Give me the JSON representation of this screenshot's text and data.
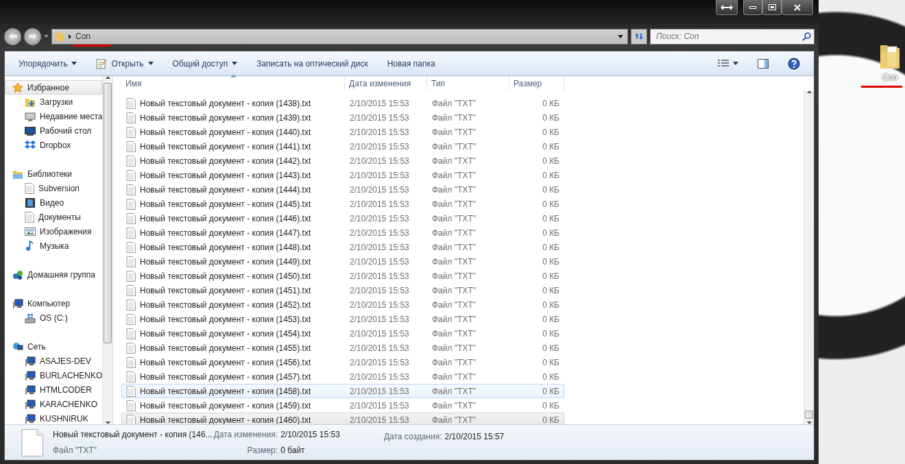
{
  "address_bar": {
    "path": "Con"
  },
  "search": {
    "placeholder": "Поиск: Con"
  },
  "toolbar": [
    {
      "label": "Упорядочить",
      "dropdown": true
    },
    {
      "label": "Открыть",
      "dropdown": true
    },
    {
      "label": "Общий доступ",
      "dropdown": true
    },
    {
      "label": "Записать на оптический диск",
      "dropdown": false
    },
    {
      "label": "Новая папка",
      "dropdown": false
    }
  ],
  "sidebar": {
    "groups": [
      {
        "label": "Избранное",
        "kind": "star",
        "selected": true,
        "children": [
          {
            "label": "Загрузки",
            "kind": "download",
            "selected": false
          },
          {
            "label": "Недавние места",
            "kind": "recent",
            "selected": false
          },
          {
            "label": "Рабочий стол",
            "kind": "desktop",
            "selected": false
          },
          {
            "label": "Dropbox",
            "kind": "dropbox",
            "selected": false
          }
        ]
      },
      {
        "label": "Библиотеки",
        "kind": "library",
        "selected": false,
        "children": [
          {
            "label": "Subversion",
            "kind": "doc",
            "selected": false
          },
          {
            "label": "Видео",
            "kind": "video",
            "selected": false
          },
          {
            "label": "Документы",
            "kind": "doc",
            "selected": false
          },
          {
            "label": "Изображения",
            "kind": "picture",
            "selected": false
          },
          {
            "label": "Музыка",
            "kind": "music",
            "selected": false
          }
        ]
      },
      {
        "label": "Домашняя группа",
        "kind": "homegroup",
        "selected": false
      },
      {
        "label": "Компьютер",
        "kind": "computer",
        "selected": false,
        "children": [
          {
            "label": "OS (C:)",
            "kind": "drive",
            "selected": false
          }
        ]
      },
      {
        "label": "Сеть",
        "kind": "network",
        "selected": false,
        "children": [
          {
            "label": "ASAJES-DEV",
            "kind": "computer",
            "selected": false
          },
          {
            "label": "BURLACHENKO",
            "kind": "computer",
            "selected": false
          },
          {
            "label": "HTMLCODER",
            "kind": "computer",
            "selected": false
          },
          {
            "label": "KARACHENKO",
            "kind": "computer",
            "selected": false
          },
          {
            "label": "KUSHNIRUK",
            "kind": "computer",
            "selected": false
          }
        ]
      }
    ]
  },
  "table": {
    "columns": [
      {
        "label": "Имя",
        "sorted": true
      },
      {
        "label": "Дата изменения",
        "sorted": false
      },
      {
        "label": "Тип",
        "sorted": false
      },
      {
        "label": "Размер",
        "sorted": false
      }
    ],
    "rows": [
      {
        "name": "Новый текстовый документ - копия (1438).txt",
        "date": "2/10/2015 15:53",
        "type": "Файл \"TXT\"",
        "size": "0 КБ",
        "selected": false,
        "hovered": false
      },
      {
        "name": "Новый текстовый документ - копия (1439).txt",
        "date": "2/10/2015 15:53",
        "type": "Файл \"TXT\"",
        "size": "0 КБ",
        "selected": false,
        "hovered": false
      },
      {
        "name": "Новый текстовый документ - копия (1440).txt",
        "date": "2/10/2015 15:53",
        "type": "Файл \"TXT\"",
        "size": "0 КБ",
        "selected": false,
        "hovered": false
      },
      {
        "name": "Новый текстовый документ - копия (1441).txt",
        "date": "2/10/2015 15:53",
        "type": "Файл \"TXT\"",
        "size": "0 КБ",
        "selected": false,
        "hovered": false
      },
      {
        "name": "Новый текстовый документ - копия (1442).txt",
        "date": "2/10/2015 15:53",
        "type": "Файл \"TXT\"",
        "size": "0 КБ",
        "selected": false,
        "hovered": false
      },
      {
        "name": "Новый текстовый документ - копия (1443).txt",
        "date": "2/10/2015 15:53",
        "type": "Файл \"TXT\"",
        "size": "0 КБ",
        "selected": false,
        "hovered": false
      },
      {
        "name": "Новый текстовый документ - копия (1444).txt",
        "date": "2/10/2015 15:53",
        "type": "Файл \"TXT\"",
        "size": "0 КБ",
        "selected": false,
        "hovered": false
      },
      {
        "name": "Новый текстовый документ - копия (1445).txt",
        "date": "2/10/2015 15:53",
        "type": "Файл \"TXT\"",
        "size": "0 КБ",
        "selected": false,
        "hovered": false
      },
      {
        "name": "Новый текстовый документ - копия (1446).txt",
        "date": "2/10/2015 15:53",
        "type": "Файл \"TXT\"",
        "size": "0 КБ",
        "selected": false,
        "hovered": false
      },
      {
        "name": "Новый текстовый документ - копия (1447).txt",
        "date": "2/10/2015 15:53",
        "type": "Файл \"TXT\"",
        "size": "0 КБ",
        "selected": false,
        "hovered": false
      },
      {
        "name": "Новый текстовый документ - копия (1448).txt",
        "date": "2/10/2015 15:53",
        "type": "Файл \"TXT\"",
        "size": "0 КБ",
        "selected": false,
        "hovered": false
      },
      {
        "name": "Новый текстовый документ - копия (1449).txt",
        "date": "2/10/2015 15:53",
        "type": "Файл \"TXT\"",
        "size": "0 КБ",
        "selected": false,
        "hovered": false
      },
      {
        "name": "Новый текстовый документ - копия (1450).txt",
        "date": "2/10/2015 15:53",
        "type": "Файл \"TXT\"",
        "size": "0 КБ",
        "selected": false,
        "hovered": false
      },
      {
        "name": "Новый текстовый документ - копия (1451).txt",
        "date": "2/10/2015 15:53",
        "type": "Файл \"TXT\"",
        "size": "0 КБ",
        "selected": false,
        "hovered": false
      },
      {
        "name": "Новый текстовый документ - копия (1452).txt",
        "date": "2/10/2015 15:53",
        "type": "Файл \"TXT\"",
        "size": "0 КБ",
        "selected": false,
        "hovered": false
      },
      {
        "name": "Новый текстовый документ - копия (1453).txt",
        "date": "2/10/2015 15:53",
        "type": "Файл \"TXT\"",
        "size": "0 КБ",
        "selected": false,
        "hovered": false
      },
      {
        "name": "Новый текстовый документ - копия (1454).txt",
        "date": "2/10/2015 15:53",
        "type": "Файл \"TXT\"",
        "size": "0 КБ",
        "selected": false,
        "hovered": false
      },
      {
        "name": "Новый текстовый документ - копия (1455).txt",
        "date": "2/10/2015 15:53",
        "type": "Файл \"TXT\"",
        "size": "0 КБ",
        "selected": false,
        "hovered": false
      },
      {
        "name": "Новый текстовый документ - копия (1456).txt",
        "date": "2/10/2015 15:53",
        "type": "Файл \"TXT\"",
        "size": "0 КБ",
        "selected": false,
        "hovered": false
      },
      {
        "name": "Новый текстовый документ - копия (1457).txt",
        "date": "2/10/2015 15:53",
        "type": "Файл \"TXT\"",
        "size": "0 КБ",
        "selected": false,
        "hovered": false
      },
      {
        "name": "Новый текстовый документ - копия (1458).txt",
        "date": "2/10/2015 15:53",
        "type": "Файл \"TXT\"",
        "size": "0 КБ",
        "selected": false,
        "hovered": true
      },
      {
        "name": "Новый текстовый документ - копия (1459).txt",
        "date": "2/10/2015 15:53",
        "type": "Файл \"TXT\"",
        "size": "0 КБ",
        "selected": false,
        "hovered": false
      },
      {
        "name": "Новый текстовый документ - копия (1460).txt",
        "date": "2/10/2015 15:53",
        "type": "Файл \"TXT\"",
        "size": "0 КБ",
        "selected": true,
        "hovered": false
      }
    ]
  },
  "details": {
    "name": "Новый текстовый документ - копия (146...",
    "type": "Файл \"TXT\"",
    "fields": [
      {
        "label": "Дата изменения:",
        "value": "2/10/2015 15:53"
      },
      {
        "label": "Размер:",
        "value": "0 байт"
      },
      {
        "label": "Дата создания:",
        "value": "2/10/2015 15:57"
      }
    ]
  },
  "desktop": {
    "icons": [
      {
        "label": "Con",
        "underlined": true
      }
    ]
  }
}
